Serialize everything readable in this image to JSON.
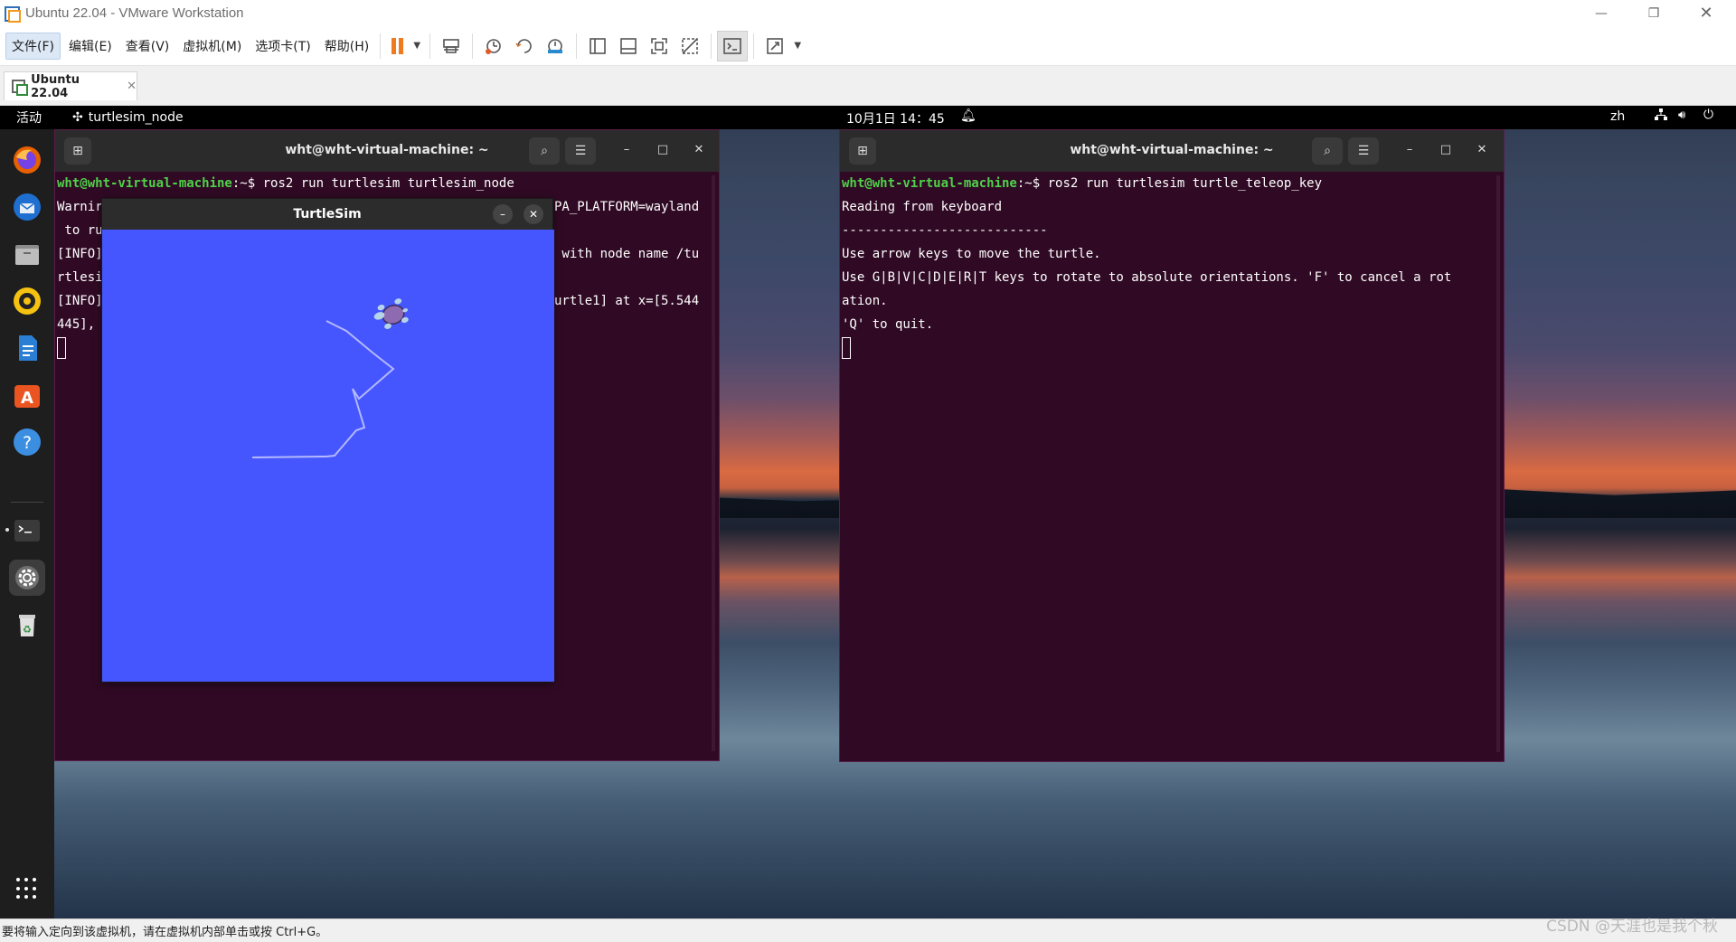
{
  "vmware": {
    "window_title": "Ubuntu 22.04 - VMware Workstation",
    "menu": [
      "文件(F)",
      "编辑(E)",
      "查看(V)",
      "虚拟机(M)",
      "选项卡(T)",
      "帮助(H)"
    ],
    "tab_label": "Ubuntu 22.04",
    "status_text": "要将输入定向到该虚拟机，请在虚拟机内部单击或按 Ctrl+G。",
    "watermark": "CSDN @天涯也是我个秋"
  },
  "gnome": {
    "activities": "活动",
    "app_name": "turtlesim_node",
    "clock": "10月1日  14：45",
    "lang": "zh"
  },
  "dock": [
    "firefox-icon",
    "thunderbird-icon",
    "files-icon",
    "rhythmbox-icon",
    "writer-icon",
    "app-center-icon",
    "help-icon",
    "terminal-icon",
    "settings-icon",
    "trash-icon"
  ],
  "terminal_left": {
    "title": "wht@wht-virtual-machine: ~",
    "prompt_user": "wht@wht-virtual-machine",
    "prompt_suffix": ":~$ ",
    "command": "ros2 run turtlesim turtlesim_node",
    "line2_left": "Warnir",
    "line2_right": "PA_PLATFORM=wayland",
    "line3_left": " to ru",
    "line4_left": "[INFO]",
    "line4_right": " with node name /tu",
    "line5_left": "rtlesi",
    "line6_left": "[INFO]",
    "line6_right": "urtle1] at x=[5.544",
    "line7_left": "445],"
  },
  "terminal_right": {
    "title": "wht@wht-virtual-machine: ~",
    "prompt_user": "wht@wht-virtual-machine",
    "prompt_suffix": ":~$ ",
    "command": "ros2 run turtlesim turtle_teleop_key",
    "lines": [
      "Reading from keyboard",
      "---------------------------",
      "Use arrow keys to move the turtle.",
      "Use G|B|V|C|D|E|R|T keys to rotate to absolute orientations. 'F' to cancel a rot",
      "ation.",
      "'Q' to quit."
    ]
  },
  "turtlesim": {
    "title": "TurtleSim",
    "background": "#4556ff",
    "pen_color": "#b3b8ff"
  }
}
